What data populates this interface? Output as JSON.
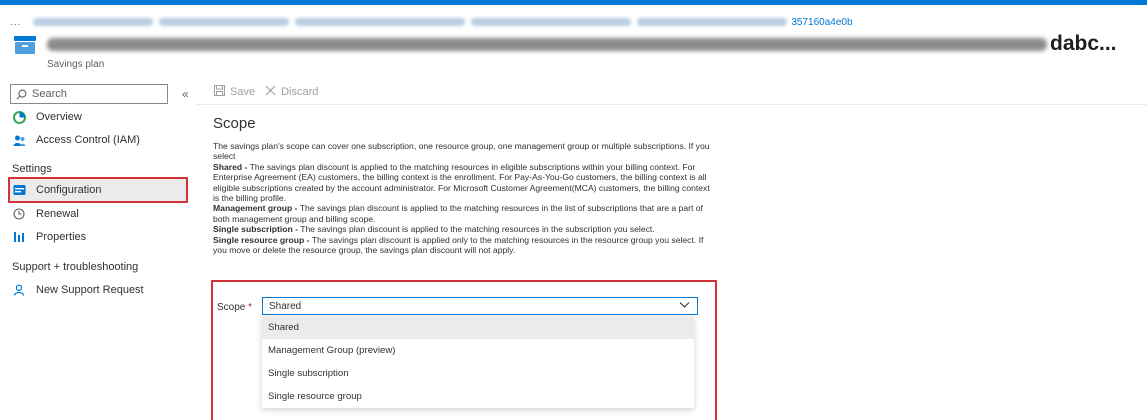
{
  "breadcrumb": {
    "overflow": "...",
    "visible_suffix": "357160a4e0b"
  },
  "header": {
    "title_suffix": "dabc...",
    "subtitle": "Savings plan"
  },
  "sidebar": {
    "search_placeholder": "Search",
    "collapse_glyph": "«",
    "items": [
      {
        "label": "Overview",
        "icon": "overview-icon"
      },
      {
        "label": "Access Control (IAM)",
        "icon": "people-icon"
      }
    ],
    "settings_heading": "Settings",
    "settings_items": [
      {
        "label": "Configuration",
        "icon": "configuration-icon",
        "selected": true
      },
      {
        "label": "Renewal",
        "icon": "clock-icon"
      },
      {
        "label": "Properties",
        "icon": "properties-icon"
      }
    ],
    "support_heading": "Support + troubleshooting",
    "support_items": [
      {
        "label": "New Support Request",
        "icon": "support-person-icon"
      }
    ]
  },
  "toolbar": {
    "save_label": "Save",
    "discard_label": "Discard"
  },
  "main": {
    "page_title": "Scope",
    "intro": "The savings plan's scope can cover one subscription, one resource group, one management group or multiple subscriptions. If you select",
    "definitions": [
      {
        "term": "Shared -",
        "text": " The savings plan discount is applied to the matching resources in eligible subscriptions within your billing context. For Enterprise Agreement (EA) customers, the billing context is the enrollment. For Pay-As-You-Go customers, the billing context is all eligible subscriptions created by the account administrator. For Microsoft Customer Agreement(MCA) customers, the billing context is the billing profile."
      },
      {
        "term": "Management group -",
        "text": " The savings plan discount is applied to the matching resources in the list of subscriptions that are a part of both management group and billing scope."
      },
      {
        "term": "Single subscription -",
        "text": " The savings plan discount is applied to the matching resources in the subscription you select."
      },
      {
        "term": "Single resource group -",
        "text": " The savings plan discount is applied only to the matching resources in the resource group you select. If you move or delete the resource group, the savings plan discount will not apply."
      }
    ],
    "scope_field": {
      "label": "Scope",
      "required_marker": "*",
      "value": "Shared",
      "options": [
        "Shared",
        "Management Group (preview)",
        "Single subscription",
        "Single resource group"
      ],
      "selected_index": 0
    }
  },
  "colors": {
    "accent": "#0078d4",
    "highlight_border": "#d13438",
    "selected_bg": "#edebe9"
  }
}
